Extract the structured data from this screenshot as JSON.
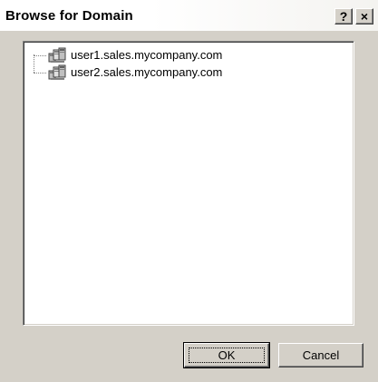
{
  "window": {
    "title": "Browse for Domain",
    "help_label": "?",
    "close_label": "×"
  },
  "tree": {
    "items": [
      {
        "label": "user1.sales.mycompany.com",
        "icon": "domain-icon"
      },
      {
        "label": "user2.sales.mycompany.com",
        "icon": "domain-icon"
      }
    ]
  },
  "buttons": {
    "ok_label": "OK",
    "cancel_label": "Cancel"
  }
}
